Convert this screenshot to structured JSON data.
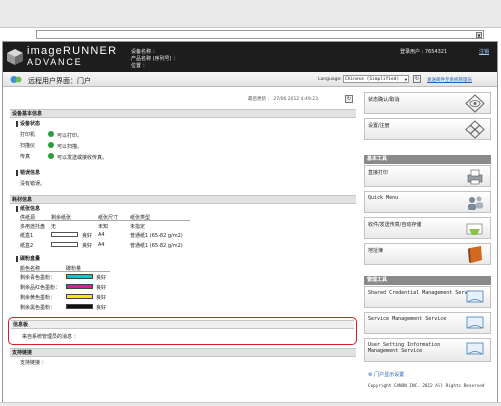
{
  "header": {
    "brand_line1": "imageRUNNER",
    "brand_line2": "ADVANCE",
    "device_name_label": "设备名称 ：",
    "product_name_label": "产品名称 (序列号) ：",
    "location_label": "位置 ：",
    "login_user": "登录用户 : 7654321",
    "logout": "注销"
  },
  "titlebar": {
    "title": "远程用户界面：门户",
    "language_label": "Language:",
    "language_value": "Chinese (Simplified)",
    "support_link": "发送邮件至系统管理员"
  },
  "main": {
    "last_updated": "最后更新 ： 27/06 2012 4:49:23",
    "device_info_header": "设备基本信息",
    "device_status_sub": "设备状态",
    "status_rows": [
      {
        "label": "打印机",
        "value": "可以打印。"
      },
      {
        "label": "扫描仪",
        "value": "可以扫描。"
      },
      {
        "label": "传真",
        "value": "可以发送或接收传真。"
      }
    ],
    "error_info_sub": "错误信息",
    "error_value": "没有错误。",
    "consumables_header": "耗材信息",
    "paper_sub": "纸张信息",
    "paper_cols": [
      "供纸源",
      "剩余纸张",
      "纸张尺寸",
      "纸张类型"
    ],
    "paper_rows": [
      {
        "source": "多用途托盘",
        "remaining": "无",
        "size": "未知",
        "type": "未指定"
      },
      {
        "source": "纸盒1",
        "remaining": "良好",
        "size": "A4",
        "type": "普通纸1 (65-82 g/m2)"
      },
      {
        "source": "纸盒2",
        "remaining": "良好",
        "size": "A4",
        "type": "普通纸1 (65-82 g/m2)"
      }
    ],
    "toner_sub": "碳粉盒量",
    "toner_cols": [
      "颜色名称",
      "碳粉量"
    ],
    "toner_rows": [
      {
        "label": "剩余青色墨粉：",
        "value": "良好",
        "color": "#00c8e8"
      },
      {
        "label": "剩余品红色墨粉：",
        "value": "良好",
        "color": "#e8189a"
      },
      {
        "label": "剩余黄色墨粉：",
        "value": "良好",
        "color": "#f4ec00"
      },
      {
        "label": "剩余黑色墨粉：",
        "value": "良好",
        "color": "#111111"
      }
    ],
    "message_header": "信息板",
    "message_text": "来自系统管理员的消息 ：",
    "support_header": "支持链接",
    "support_text": "支持链接 ："
  },
  "sidebar": {
    "top_buttons": [
      {
        "label": "状态确认/取消"
      },
      {
        "label": "设置/注册"
      }
    ],
    "basic_tools_header": "基本工具",
    "basic_tools": [
      {
        "label": "直接打印"
      },
      {
        "label": "Quick Menu"
      },
      {
        "label": "收件/发送传真/自动存储"
      },
      {
        "label": "地址簿"
      }
    ],
    "admin_tools_header": "管理工具",
    "admin_tools": [
      {
        "label": "Shared Credential Management Service"
      },
      {
        "label": "Service Management Service"
      },
      {
        "label": "User Setting Information Management Service"
      }
    ],
    "portal_settings": "门户显示设置",
    "copyright": "Copyright CANON INC. 2012 All Rights Reserved"
  }
}
